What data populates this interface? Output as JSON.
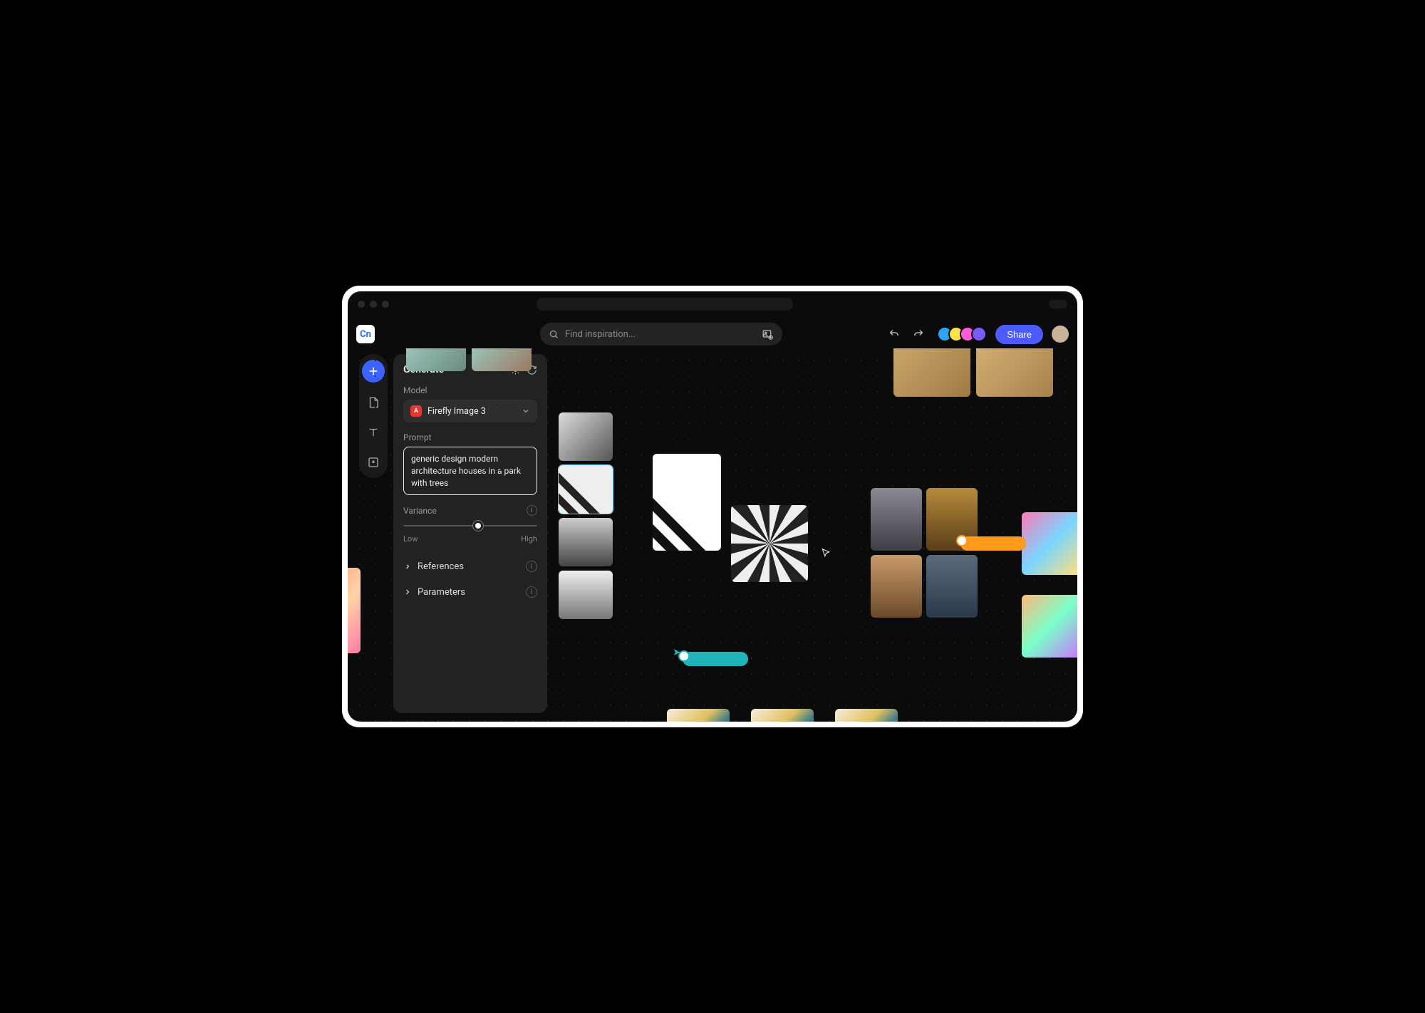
{
  "app": {
    "logo_text": "Cn"
  },
  "search": {
    "placeholder": "Find inspiration..."
  },
  "toolbar": {
    "share_label": "Share"
  },
  "panel": {
    "title": "Generate",
    "model_label": "Model",
    "model_value": "Firefly Image 3",
    "prompt_label": "Prompt",
    "prompt_value": "generic design modern architecture houses in a park with trees",
    "variance_label": "Variance",
    "variance_low": "Low",
    "variance_high": "High",
    "references_label": "References",
    "parameters_label": "Parameters"
  }
}
